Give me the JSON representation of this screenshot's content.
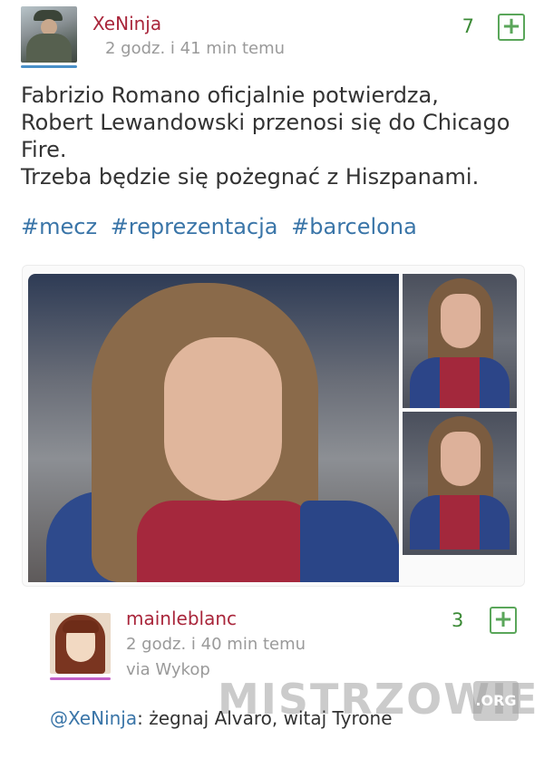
{
  "post": {
    "username": "XeNinja",
    "timestamp": "2 godz. i 41 min temu",
    "votes": "7",
    "plus_label": "+",
    "body_lines": [
      "Fabrizio Romano oficjalnie potwierdza,",
      "Robert Lewandowski przenosi się do Chicago",
      "Fire.",
      "Trzeba będzie się pożegnać z Hiszpanami."
    ],
    "tags": [
      "#mecz",
      "#reprezentacja",
      "#barcelona"
    ]
  },
  "comment": {
    "username": "mainleblanc",
    "timestamp": "2 godz. i 40 min temu",
    "via": "via Wykop",
    "votes": "3",
    "plus_label": "+",
    "mention": "@XeNinja",
    "text": ": żegnaj Alvaro, witaj Tyrone"
  },
  "watermark": {
    "text": "MISTRZOWIE",
    "badge": ".ORG"
  },
  "colors": {
    "username": "#a9263b",
    "vote_green": "#3b8a36",
    "tag_blue": "#3a75a8",
    "avatar_underline_post": "#4a90c8",
    "avatar_underline_comment": "#c361c8"
  }
}
